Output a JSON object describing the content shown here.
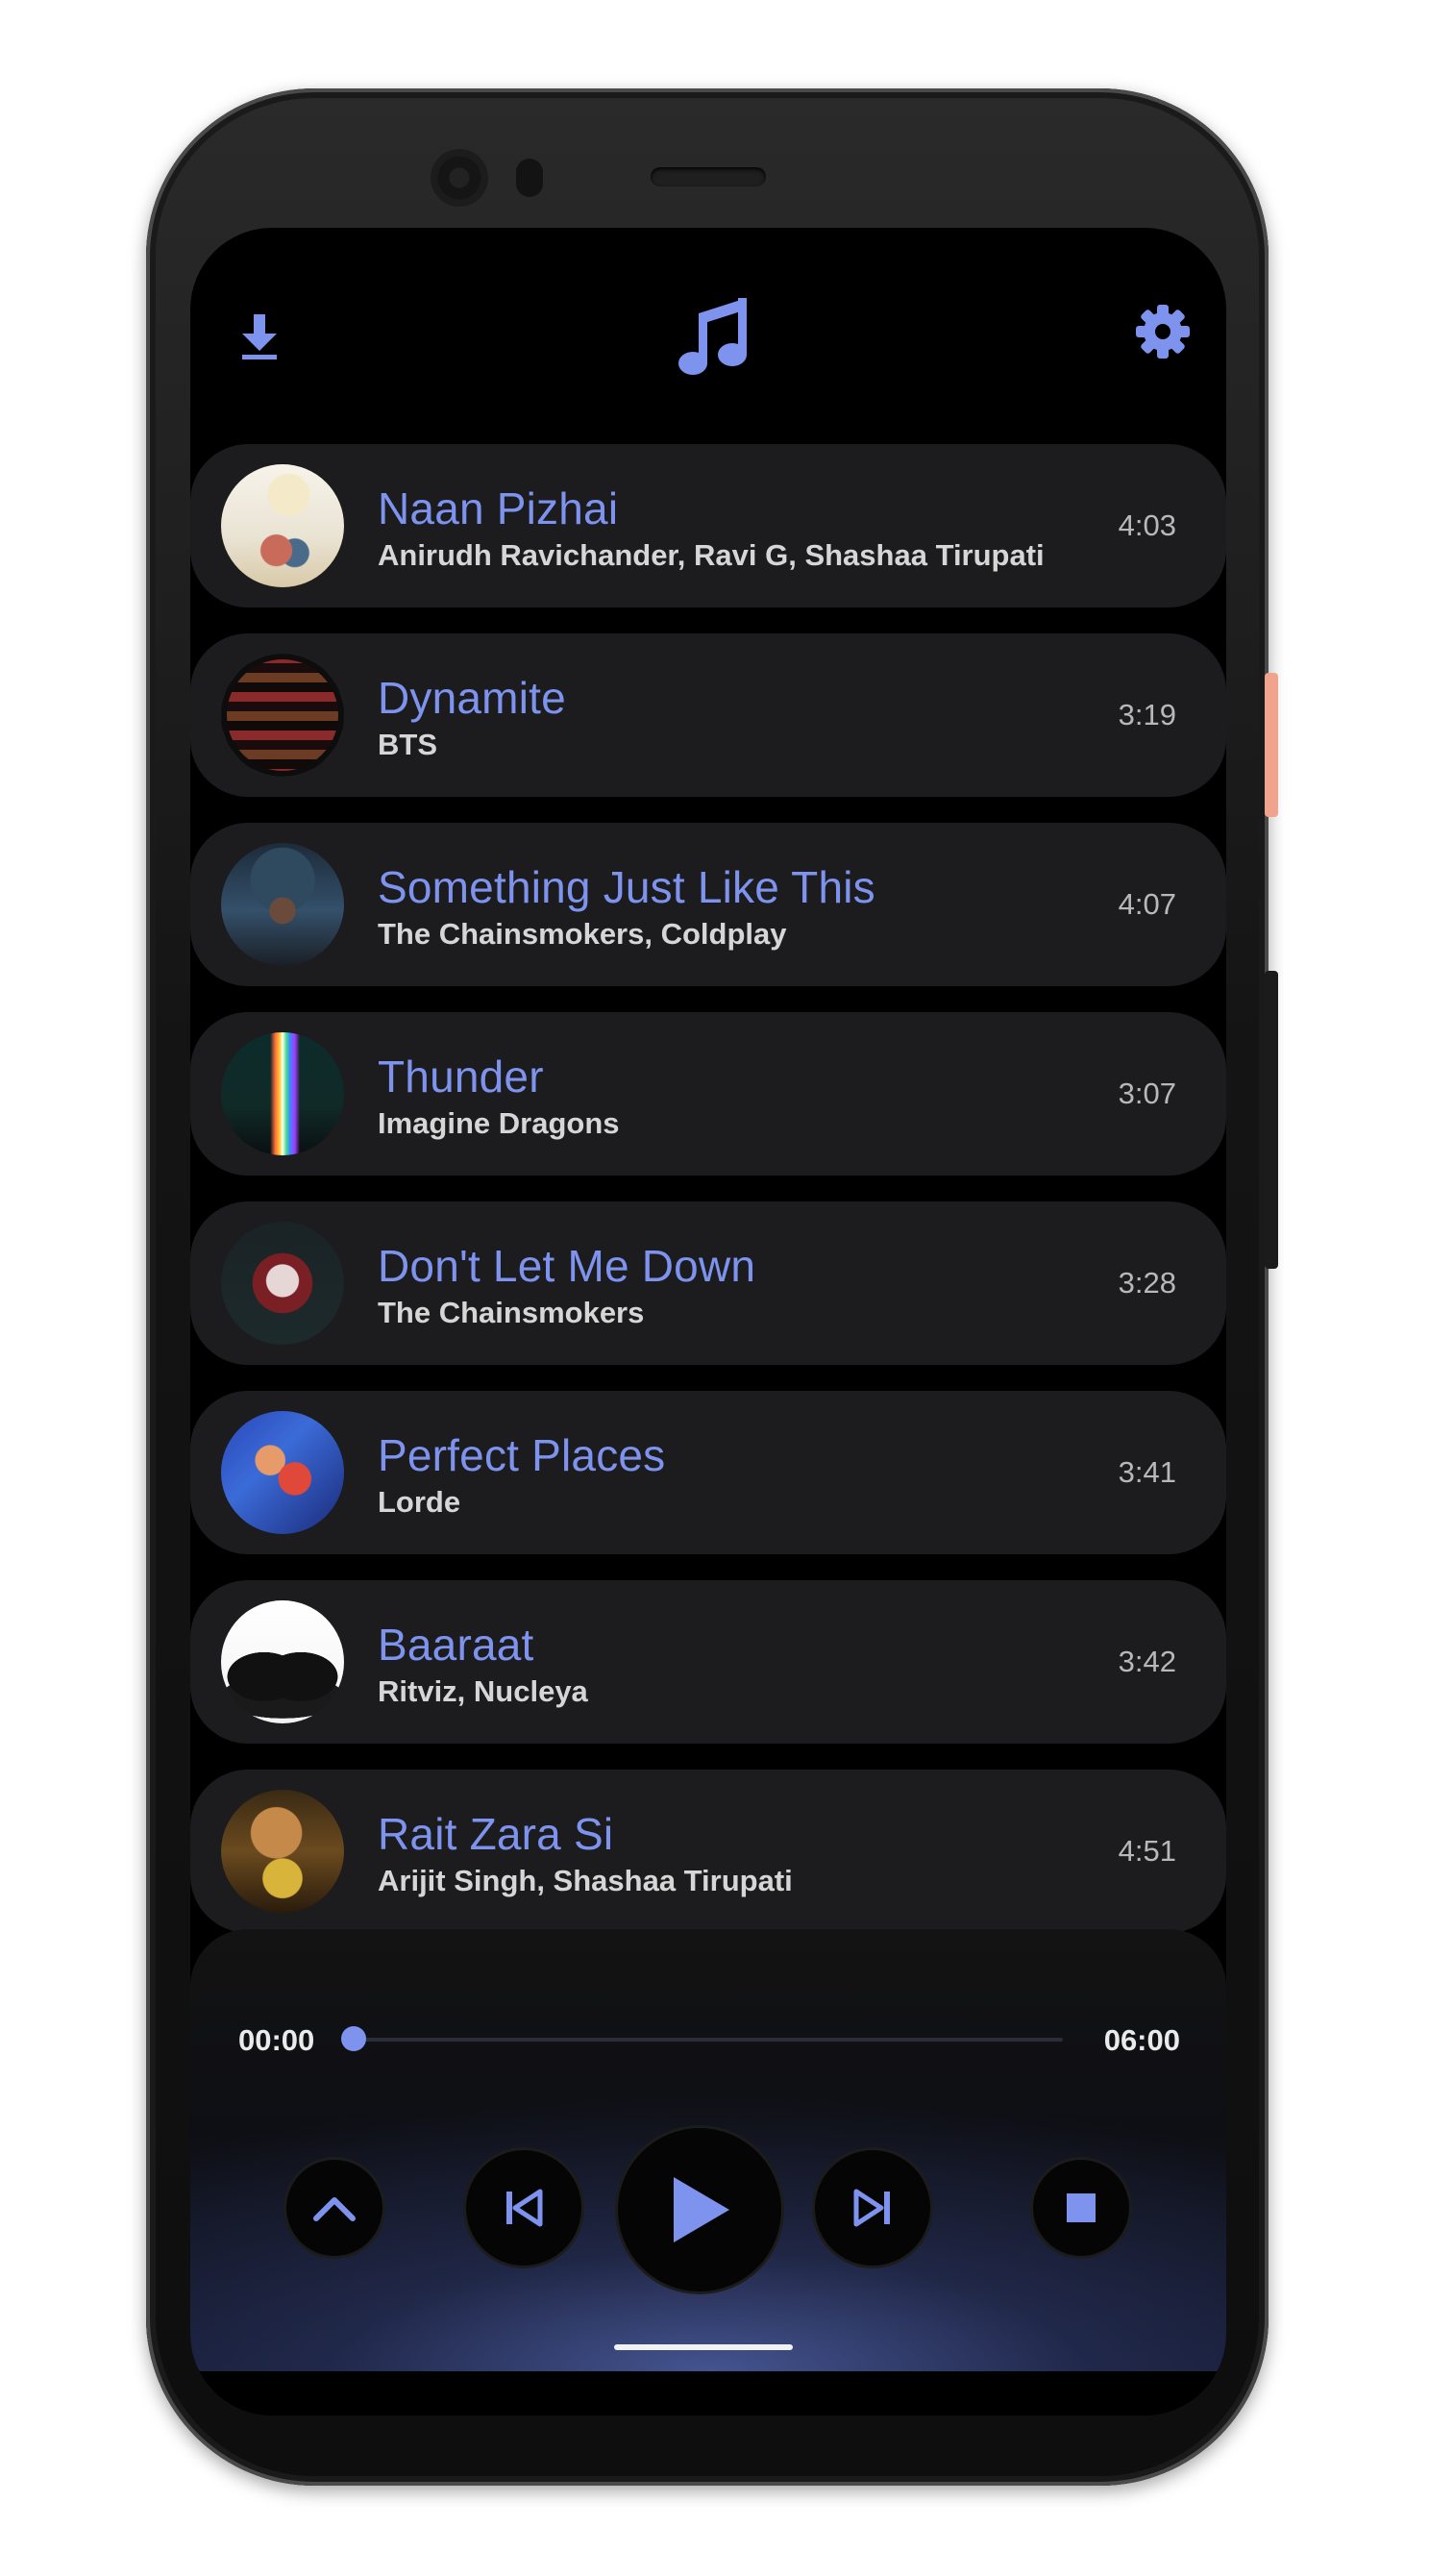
{
  "app": {
    "name": "Music Player",
    "accent_color": "#7d93ee",
    "background_color": "#000000",
    "card_color": "#1c1c1e"
  },
  "topbar": {
    "left_icon": "download-icon",
    "center_icon": "music-note-icon",
    "right_icon": "gear-icon"
  },
  "songs": [
    {
      "title": "Naan Pizhai",
      "artist": "Anirudh Ravichander, Ravi G, Shashaa Tirupati",
      "duration": "4:03"
    },
    {
      "title": "Dynamite",
      "artist": "BTS",
      "duration": "3:19"
    },
    {
      "title": "Something Just Like This",
      "artist": "The Chainsmokers, Coldplay",
      "duration": "4:07"
    },
    {
      "title": "Thunder",
      "artist": "Imagine Dragons",
      "duration": "3:07"
    },
    {
      "title": "Don't Let Me Down",
      "artist": "The Chainsmokers",
      "duration": "3:28"
    },
    {
      "title": "Perfect Places",
      "artist": "Lorde",
      "duration": "3:41"
    },
    {
      "title": "Baaraat",
      "artist": "Ritviz, Nucleya",
      "duration": "3:42"
    },
    {
      "title": "Rait Zara Si",
      "artist": "Arijit Singh, Shashaa Tirupati",
      "duration": "4:51"
    }
  ],
  "player": {
    "current_time": "00:00",
    "total_time": "06:00",
    "progress": 0,
    "controls": [
      "chevron-up-icon",
      "skip-previous-icon",
      "play-icon",
      "skip-next-icon",
      "stop-icon"
    ]
  }
}
